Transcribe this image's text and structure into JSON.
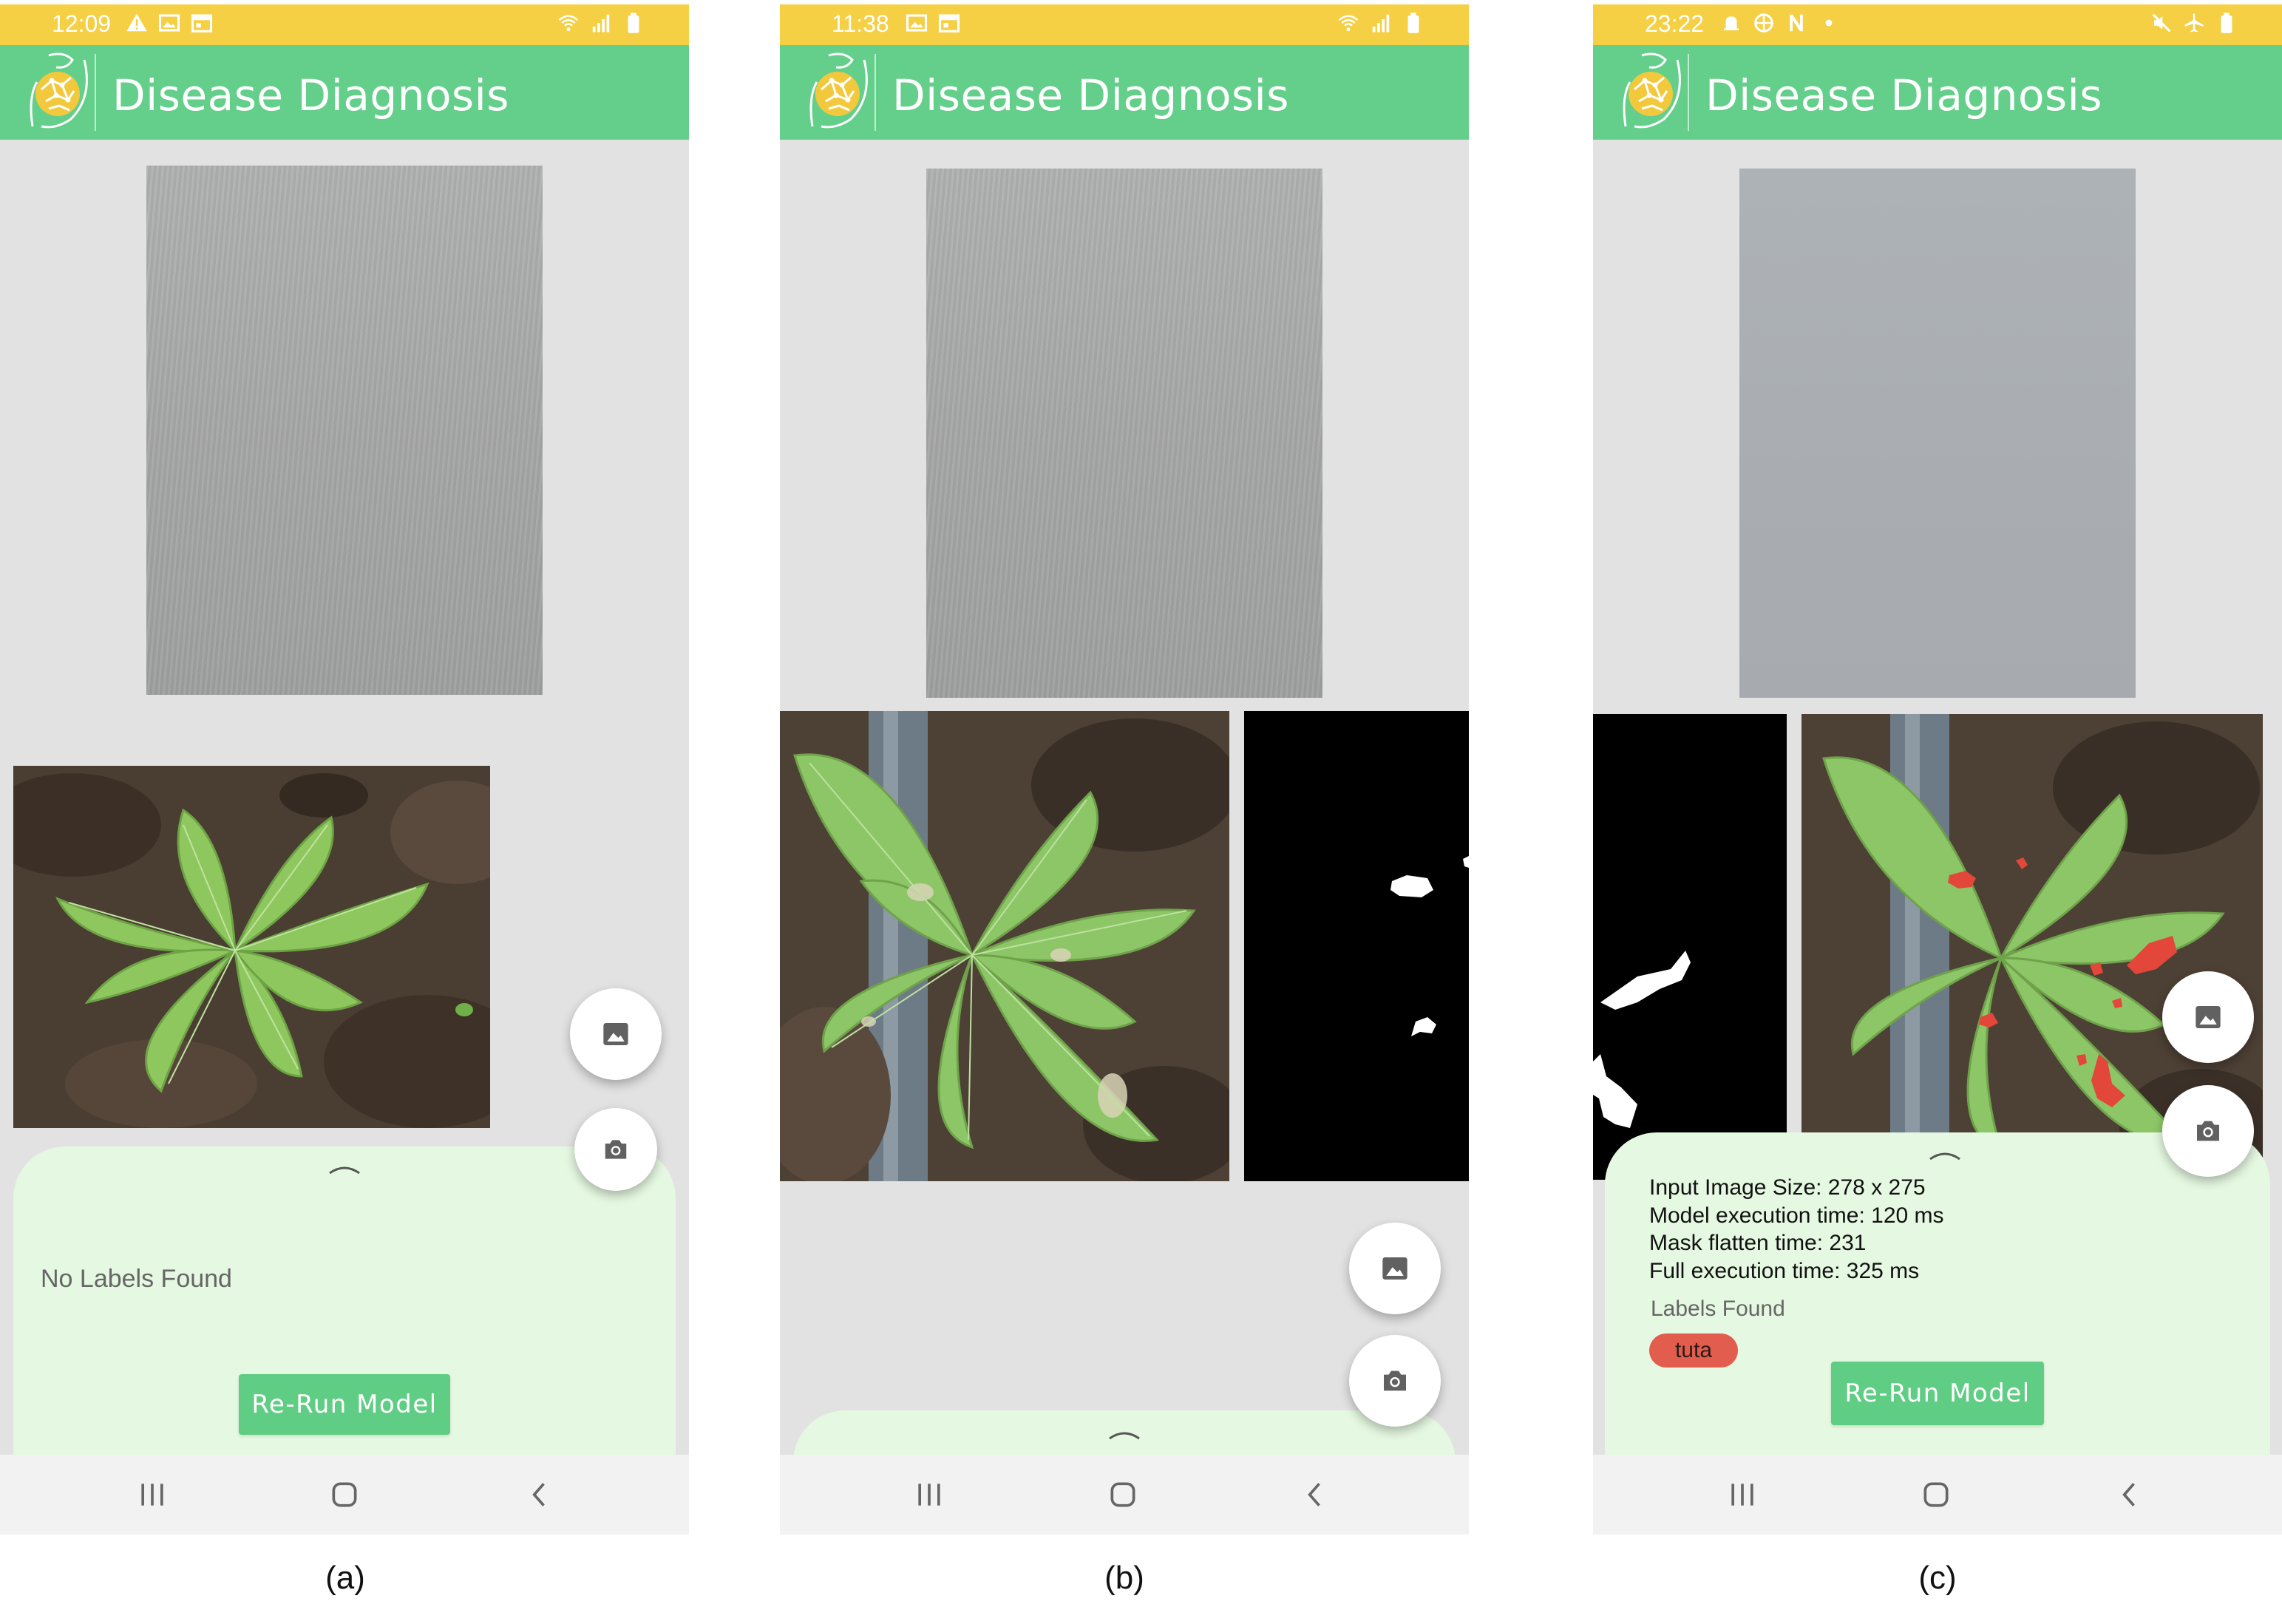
{
  "app": {
    "title": "Disease Diagnosis",
    "logo_icon": "tomato-brain-logo-icon"
  },
  "colors": {
    "status_bar": "#f5cf44",
    "app_bar": "#63cf8a",
    "screen_bg": "#e2e2e2",
    "sheet_bg": "#e5f8e1",
    "button": "#5fcd84",
    "label_chip": "#e35d4f"
  },
  "panels": [
    {
      "caption": "(a)",
      "status_time": "12:09",
      "status_left_icons": [
        "warning-icon",
        "image-icon",
        "calendar-icon"
      ],
      "status_right_icons": [
        "wifi-icon",
        "signal-icon",
        "battery-icon"
      ],
      "result_message": "No Labels Found",
      "rerun_label": "Re-Run Model"
    },
    {
      "caption": "(b)",
      "status_time": "11:38",
      "status_left_icons": [
        "image-icon",
        "calendar-icon"
      ],
      "status_right_icons": [
        "wifi-icon",
        "signal-icon",
        "battery-icon"
      ]
    },
    {
      "caption": "(c)",
      "status_time": "23:22",
      "status_left_icons": [
        "alarm-icon",
        "globe-icon",
        "n-icon",
        "dot-icon"
      ],
      "status_right_icons": [
        "mute-icon",
        "airplane-icon",
        "battery-icon"
      ],
      "stats": [
        "Input Image Size: 278 x 275",
        "Model execution time: 120 ms",
        "Mask flatten time: 231",
        "Full execution time: 325 ms"
      ],
      "labels_heading": "Labels Found",
      "labels": [
        "tuta"
      ],
      "rerun_label": "Re-Run Model"
    }
  ],
  "fab_icons": {
    "gallery": "gallery-icon",
    "camera": "camera-icon"
  },
  "nav_icons": [
    "recents-icon",
    "home-icon",
    "back-icon"
  ]
}
